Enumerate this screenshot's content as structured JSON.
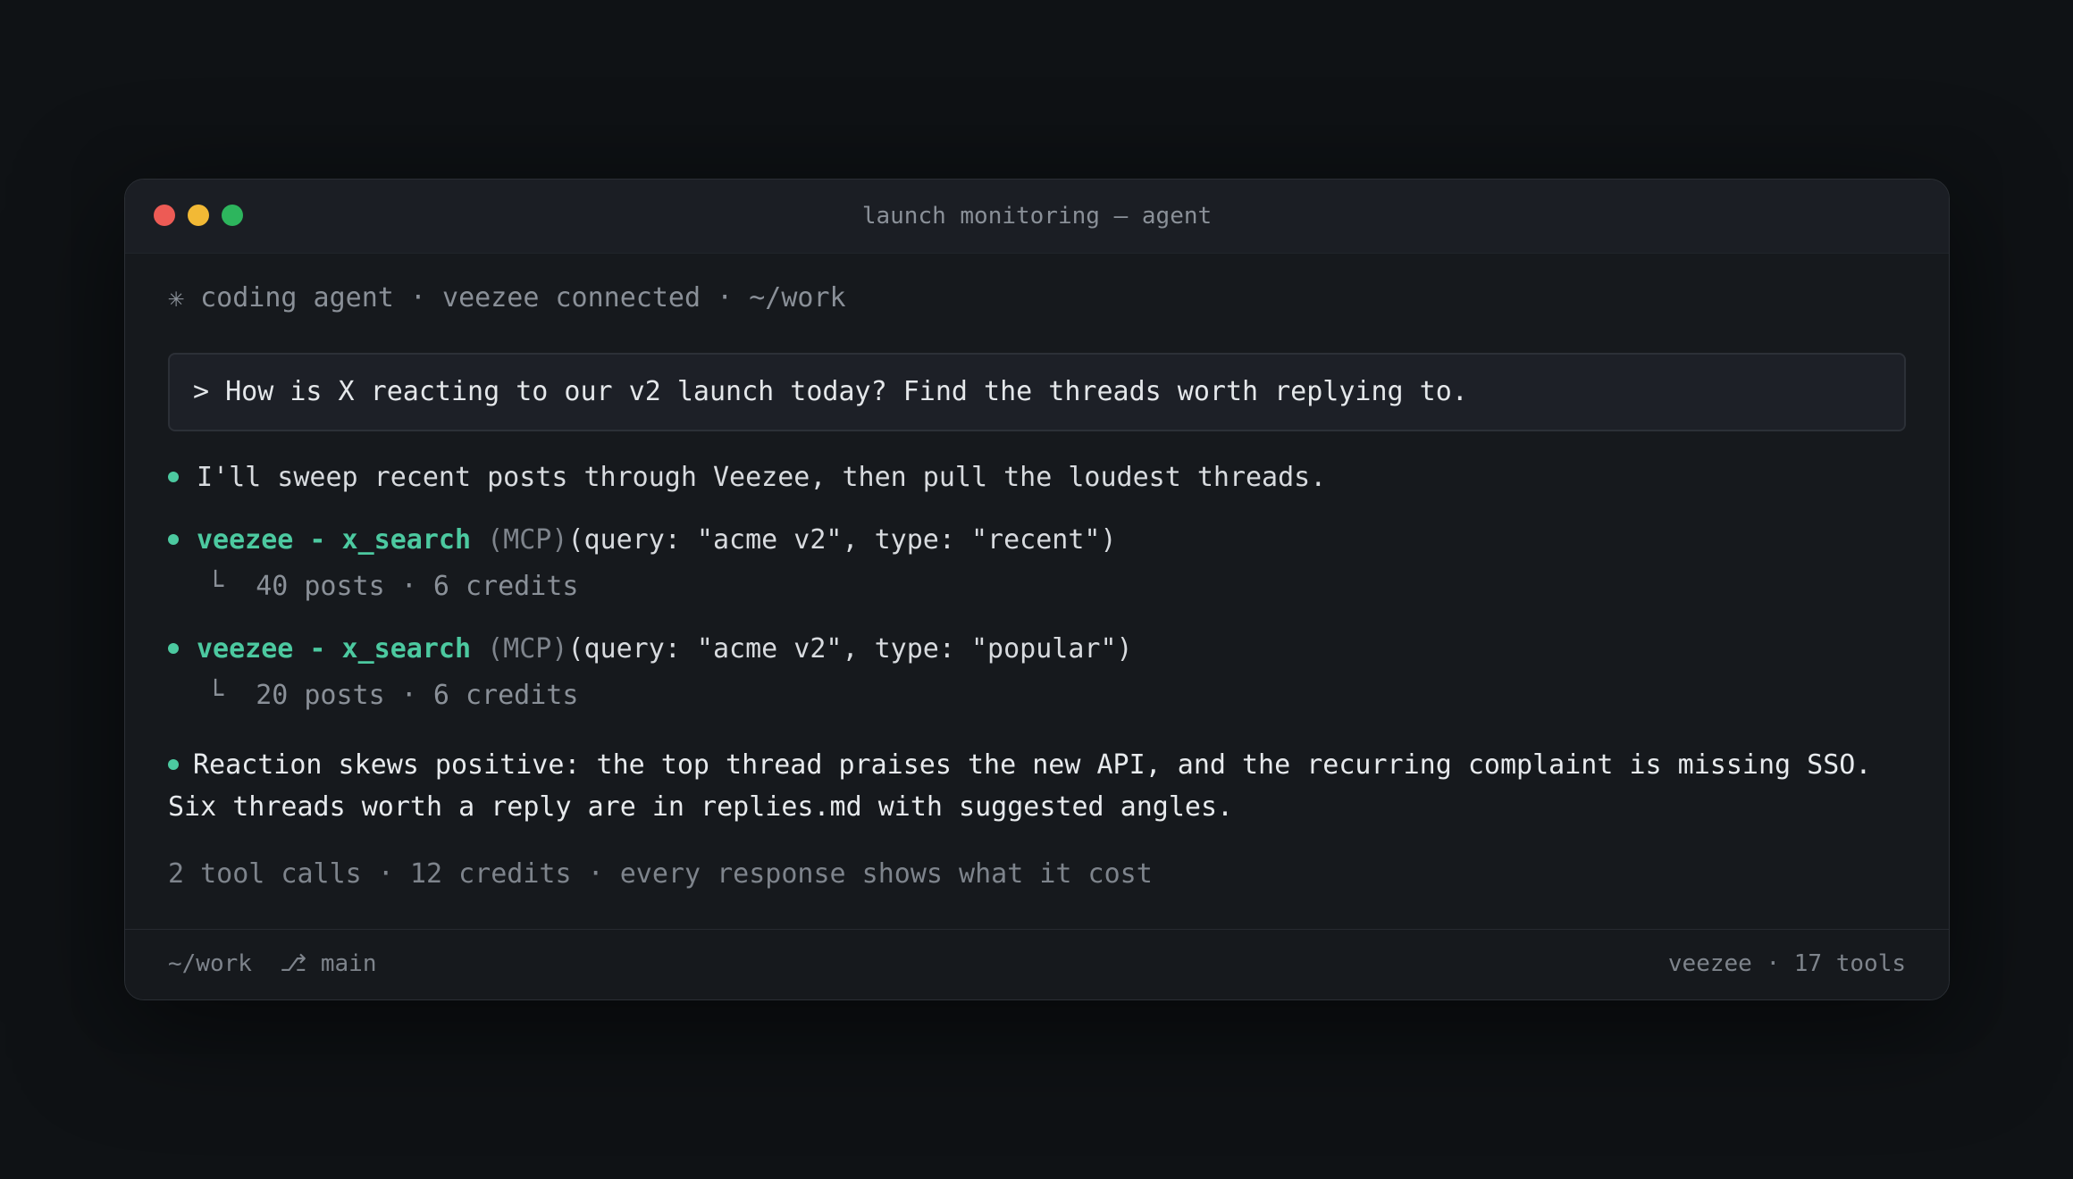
{
  "window": {
    "title": "launch monitoring — agent"
  },
  "session": {
    "header": "✳ coding agent · veezee connected · ~/work"
  },
  "prompt": {
    "text": "> How is X reacting to our v2 launch today? Find the threads worth replying to."
  },
  "transcript": {
    "intro": "I'll sweep recent posts through Veezee, then pull the loudest threads.",
    "calls": [
      {
        "tool": "veezee - x_search",
        "source": "(MCP)",
        "args": "(query: \"acme v2\", type: \"recent\")",
        "result_prefix": "└",
        "result": "40 posts · 6 credits"
      },
      {
        "tool": "veezee - x_search",
        "source": "(MCP)",
        "args": "(query: \"acme v2\", type: \"popular\")",
        "result_prefix": "└",
        "result": "20 posts · 6 credits"
      }
    ],
    "summary_line1": "Reaction skews positive: the top thread praises the new API, and the recurring complaint is missing SSO.",
    "summary_line2": "Six threads worth a reply are in replies.md with suggested angles.",
    "cost_line": "2 tool calls · 12 credits · every response shows what it cost"
  },
  "statusbar": {
    "cwd": "~/work",
    "branch_icon": "⎇",
    "branch": "main",
    "right": "veezee · 17 tools"
  },
  "colors": {
    "accent": "#4cc9a0",
    "close": "#ed5b55",
    "minimize": "#f2b935",
    "maximize": "#2db55d"
  }
}
